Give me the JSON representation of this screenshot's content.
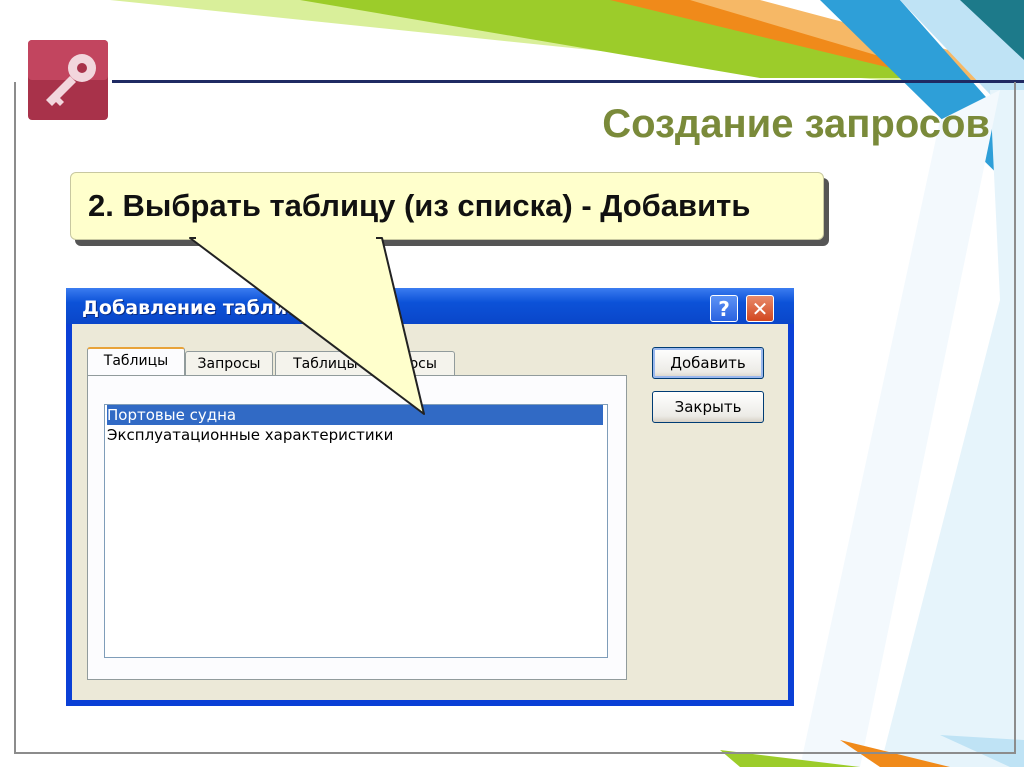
{
  "slide": {
    "title": "Создание запросов",
    "callout": "2. Выбрать таблицу (из списка) - Добавить",
    "colors": {
      "title": "#7a8a3a",
      "callout_bg": "#ffffcc",
      "accent_orange": "#f08a1a",
      "accent_green": "#9ccc2a",
      "accent_blue": "#bfe3f5"
    }
  },
  "dialog": {
    "title": "Добавление таблицы",
    "help_button": "?",
    "close_button": "✕",
    "tabs": [
      {
        "label": "Таблицы",
        "active": true
      },
      {
        "label": "Запросы",
        "active": false
      },
      {
        "label": "Таблицы и запросы",
        "active": false
      }
    ],
    "list_items": [
      {
        "label": "Портовые судна",
        "selected": true
      },
      {
        "label": "Эксплуатационные характеристики",
        "selected": false
      }
    ],
    "add_button": "Добавить",
    "close_label": "Закрыть"
  },
  "icons": {
    "app_logo": "access-key-icon"
  }
}
